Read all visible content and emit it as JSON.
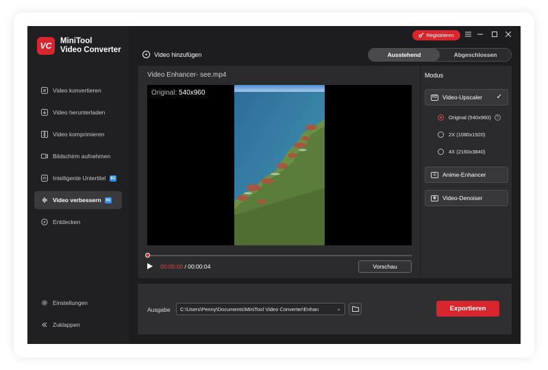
{
  "app": {
    "logo_mark": "VC",
    "title_line1": "MiniTool",
    "title_line2": "Video Converter"
  },
  "titlebar": {
    "register_label": "Registrieren"
  },
  "sidebar": {
    "items": [
      {
        "label": "Video konvertieren",
        "icon": "convert-icon"
      },
      {
        "label": "Video herunterladen",
        "icon": "download-icon"
      },
      {
        "label": "Video komprimieren",
        "icon": "compress-icon"
      },
      {
        "label": "Bildschirm aufnehmen",
        "icon": "record-icon"
      },
      {
        "label": "Intelligente Untertitel",
        "icon": "subtitle-icon",
        "badge": "KI"
      },
      {
        "label": "Video verbessern",
        "icon": "enhance-icon",
        "badge": "KI",
        "active": true
      },
      {
        "label": "Entdecken",
        "icon": "explore-icon"
      }
    ],
    "settings_label": "Einstellungen",
    "collapse_label": "Zuklappen"
  },
  "toolbar": {
    "add_video_label": "Video hinzufügen"
  },
  "tabs": [
    {
      "label": "Ausstehend",
      "active": true
    },
    {
      "label": "Abgeschlossen"
    }
  ],
  "editor": {
    "file_title": "Video Enhancer- see.mp4",
    "original_prefix": "Original:",
    "original_resolution": "540x960",
    "time_current": "00:00:00",
    "time_separator": "/",
    "time_total": "00:00:04",
    "preview_label": "Vorschau",
    "progress": 0
  },
  "mode": {
    "heading": "Modus",
    "upscaler_label": "Video-Upscaler",
    "options": [
      {
        "label": "Original (540x960)",
        "selected": true
      },
      {
        "label": "2X (1080x1920)",
        "selected": false
      },
      {
        "label": "4X (2160x3840)",
        "selected": false
      }
    ],
    "anime_label": "Anime-Enhancer",
    "denoiser_label": "Video-Denoiser"
  },
  "output": {
    "label": "Ausgabe",
    "path": "C:\\Users\\Penny\\Documents\\MiniTool Video Converter\\Enhan",
    "export_label": "Exportieren"
  },
  "colors": {
    "accent": "#d7262e",
    "badge": "#2f8cf0",
    "background": "#1d1d1f"
  }
}
